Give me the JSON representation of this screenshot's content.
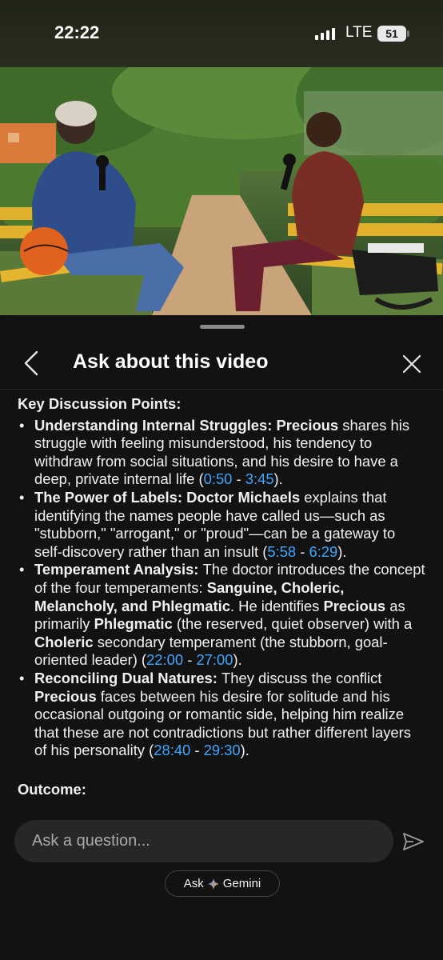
{
  "status_bar": {
    "time": "22:22",
    "network": "LTE",
    "battery": "51"
  },
  "sheet": {
    "title": "Ask about this video",
    "section_heading": "Key Discussion Points:",
    "points": [
      {
        "parts": [
          {
            "text": "Understanding Internal Struggles: ",
            "bold": true
          },
          {
            "text": "Precious",
            "bold": true
          },
          {
            "text": " shares his struggle with feeling misunderstood, his tendency to withdraw from social situations, and his desire to have a deep, private internal life ("
          },
          {
            "text": "0:50",
            "link": true
          },
          {
            "text": " - "
          },
          {
            "text": "3:45",
            "link": true
          },
          {
            "text": ")."
          }
        ]
      },
      {
        "parts": [
          {
            "text": "The Power of Labels: ",
            "bold": true
          },
          {
            "text": "Doctor Michaels",
            "bold": true
          },
          {
            "text": " explains that identifying the names people have called us—such as \"stubborn,\" \"arrogant,\" or \"proud\"—can be a gateway to self-discovery rather than an insult ("
          },
          {
            "text": "5:58",
            "link": true
          },
          {
            "text": " - "
          },
          {
            "text": "6:29",
            "link": true
          },
          {
            "text": ")."
          }
        ]
      },
      {
        "parts": [
          {
            "text": "Temperament Analysis: ",
            "bold": true
          },
          {
            "text": "The doctor introduces the concept of the four temperaments: "
          },
          {
            "text": "Sanguine, Choleric, Melancholy, and Phlegmatic",
            "bold": true
          },
          {
            "text": ". He identifies "
          },
          {
            "text": "Precious",
            "bold": true
          },
          {
            "text": " as primarily "
          },
          {
            "text": "Phlegmatic",
            "bold": true
          },
          {
            "text": " (the reserved, quiet observer) with a "
          },
          {
            "text": "Choleric",
            "bold": true
          },
          {
            "text": " secondary temperament (the stubborn, goal-oriented leader) ("
          },
          {
            "text": "22:00",
            "link": true
          },
          {
            "text": " - "
          },
          {
            "text": "27:00",
            "link": true
          },
          {
            "text": ")."
          }
        ]
      },
      {
        "parts": [
          {
            "text": "Reconciling Dual Natures: ",
            "bold": true
          },
          {
            "text": "They discuss the conflict "
          },
          {
            "text": "Precious",
            "bold": true
          },
          {
            "text": " faces between his desire for solitude and his occasional outgoing or romantic side, helping him realize that these are not contradictions but rather different layers of his personality ("
          },
          {
            "text": "28:40",
            "link": true
          },
          {
            "text": " - "
          },
          {
            "text": "29:30",
            "link": true
          },
          {
            "text": ")."
          }
        ]
      }
    ],
    "outcome_heading": "Outcome:"
  },
  "input": {
    "placeholder": "Ask a question..."
  },
  "ask_gemini": {
    "label_prefix": "Ask",
    "label_suffix": "Gemini"
  },
  "colors": {
    "link": "#3ea6ff",
    "background": "#121212",
    "input_bg": "#272727"
  }
}
